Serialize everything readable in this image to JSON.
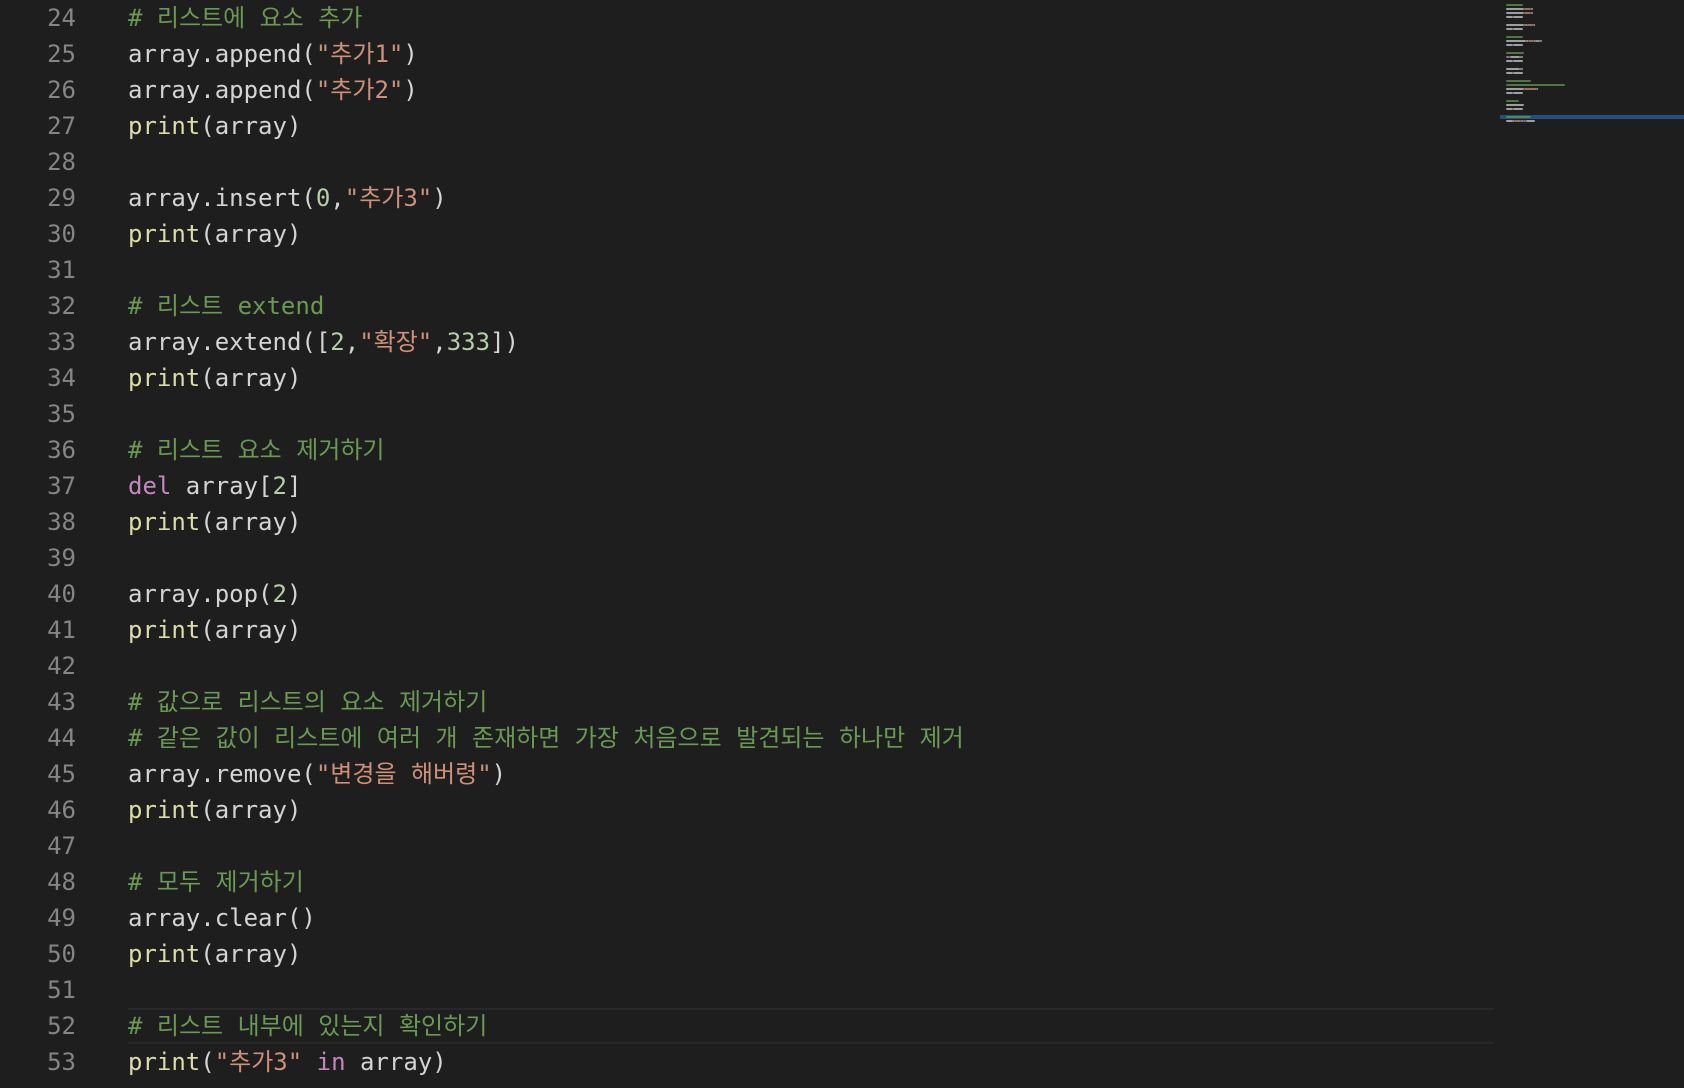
{
  "editor": {
    "language": "python",
    "current_line": "52",
    "colors": {
      "background": "#1e1e1e",
      "line_number": "#858585",
      "comment": "#6a9955",
      "string": "#ce9178",
      "number": "#b5cea8",
      "function": "#dcdcaa",
      "keyword": "#c586c0",
      "plain": "#d4d4d4"
    },
    "lines": [
      {
        "number": "24",
        "tokens": [
          {
            "t": "comment",
            "v": "# 리스트에 요소 추가"
          }
        ]
      },
      {
        "number": "25",
        "tokens": [
          {
            "t": "plain",
            "v": "array.append("
          },
          {
            "t": "string",
            "v": "\"추가1\""
          },
          {
            "t": "plain",
            "v": ")"
          }
        ]
      },
      {
        "number": "26",
        "tokens": [
          {
            "t": "plain",
            "v": "array.append("
          },
          {
            "t": "string",
            "v": "\"추가2\""
          },
          {
            "t": "plain",
            "v": ")"
          }
        ]
      },
      {
        "number": "27",
        "tokens": [
          {
            "t": "func",
            "v": "print"
          },
          {
            "t": "plain",
            "v": "(array)"
          }
        ]
      },
      {
        "number": "28",
        "tokens": []
      },
      {
        "number": "29",
        "tokens": [
          {
            "t": "plain",
            "v": "array.insert("
          },
          {
            "t": "number",
            "v": "0"
          },
          {
            "t": "plain",
            "v": ","
          },
          {
            "t": "string",
            "v": "\"추가3\""
          },
          {
            "t": "plain",
            "v": ")"
          }
        ]
      },
      {
        "number": "30",
        "tokens": [
          {
            "t": "func",
            "v": "print"
          },
          {
            "t": "plain",
            "v": "(array)"
          }
        ]
      },
      {
        "number": "31",
        "tokens": []
      },
      {
        "number": "32",
        "tokens": [
          {
            "t": "comment",
            "v": "# 리스트 extend"
          }
        ]
      },
      {
        "number": "33",
        "tokens": [
          {
            "t": "plain",
            "v": "array.extend(["
          },
          {
            "t": "number",
            "v": "2"
          },
          {
            "t": "plain",
            "v": ","
          },
          {
            "t": "string",
            "v": "\"확장\""
          },
          {
            "t": "plain",
            "v": ","
          },
          {
            "t": "number",
            "v": "333"
          },
          {
            "t": "plain",
            "v": "])"
          }
        ]
      },
      {
        "number": "34",
        "tokens": [
          {
            "t": "func",
            "v": "print"
          },
          {
            "t": "plain",
            "v": "(array)"
          }
        ]
      },
      {
        "number": "35",
        "tokens": []
      },
      {
        "number": "36",
        "tokens": [
          {
            "t": "comment",
            "v": "# 리스트 요소 제거하기"
          }
        ]
      },
      {
        "number": "37",
        "tokens": [
          {
            "t": "keyword",
            "v": "del"
          },
          {
            "t": "plain",
            "v": " array["
          },
          {
            "t": "number",
            "v": "2"
          },
          {
            "t": "plain",
            "v": "]"
          }
        ]
      },
      {
        "number": "38",
        "tokens": [
          {
            "t": "func",
            "v": "print"
          },
          {
            "t": "plain",
            "v": "(array)"
          }
        ]
      },
      {
        "number": "39",
        "tokens": []
      },
      {
        "number": "40",
        "tokens": [
          {
            "t": "plain",
            "v": "array.pop("
          },
          {
            "t": "number",
            "v": "2"
          },
          {
            "t": "plain",
            "v": ")"
          }
        ]
      },
      {
        "number": "41",
        "tokens": [
          {
            "t": "func",
            "v": "print"
          },
          {
            "t": "plain",
            "v": "(array)"
          }
        ]
      },
      {
        "number": "42",
        "tokens": []
      },
      {
        "number": "43",
        "tokens": [
          {
            "t": "comment",
            "v": "# 값으로 리스트의 요소 제거하기"
          }
        ]
      },
      {
        "number": "44",
        "tokens": [
          {
            "t": "comment",
            "v": "# 같은 값이 리스트에 여러 개 존재하면 가장 처음으로 발견되는 하나만 제거"
          }
        ]
      },
      {
        "number": "45",
        "tokens": [
          {
            "t": "plain",
            "v": "array.remove("
          },
          {
            "t": "string",
            "v": "\"변경을 해버령\""
          },
          {
            "t": "plain",
            "v": ")"
          }
        ]
      },
      {
        "number": "46",
        "tokens": [
          {
            "t": "func",
            "v": "print"
          },
          {
            "t": "plain",
            "v": "(array)"
          }
        ]
      },
      {
        "number": "47",
        "tokens": []
      },
      {
        "number": "48",
        "tokens": [
          {
            "t": "comment",
            "v": "# 모두 제거하기"
          }
        ]
      },
      {
        "number": "49",
        "tokens": [
          {
            "t": "plain",
            "v": "array.clear()"
          }
        ]
      },
      {
        "number": "50",
        "tokens": [
          {
            "t": "func",
            "v": "print"
          },
          {
            "t": "plain",
            "v": "(array)"
          }
        ]
      },
      {
        "number": "51",
        "tokens": []
      },
      {
        "number": "52",
        "tokens": [
          {
            "t": "comment",
            "v": "# 리스트 내부에 있는지 확인하기"
          }
        ]
      },
      {
        "number": "53",
        "tokens": [
          {
            "t": "func",
            "v": "print"
          },
          {
            "t": "plain",
            "v": "("
          },
          {
            "t": "string",
            "v": "\"추가3\""
          },
          {
            "t": "plain",
            "v": " "
          },
          {
            "t": "keyword",
            "v": "in"
          },
          {
            "t": "plain",
            "v": " array)"
          }
        ]
      }
    ]
  }
}
